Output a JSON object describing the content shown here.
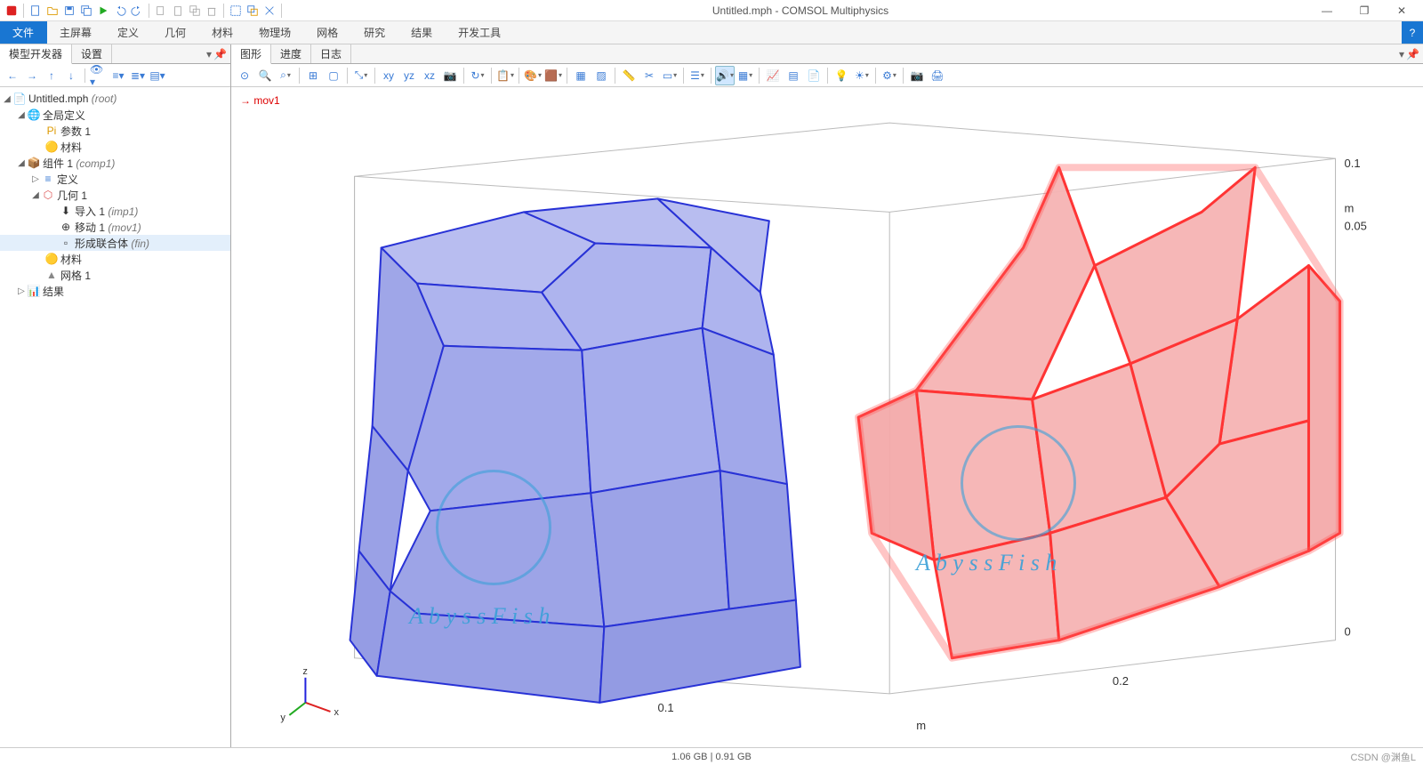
{
  "window": {
    "title": "Untitled.mph - COMSOL Multiphysics"
  },
  "ribbon": {
    "file": "文件",
    "tabs": [
      "主屏幕",
      "定义",
      "几何",
      "材料",
      "物理场",
      "网格",
      "研究",
      "结果",
      "开发工具"
    ],
    "help": "?"
  },
  "left": {
    "tabs": {
      "builder": "模型开发器",
      "settings": "设置"
    },
    "tree": {
      "root": {
        "label": "Untitled.mph",
        "suffix": "(root)"
      },
      "global": "全局定义",
      "params": "参数 1",
      "materials": "材料",
      "comp": {
        "label": "组件 1",
        "suffix": "(comp1)"
      },
      "defs": "定义",
      "geom": "几何 1",
      "imp": {
        "label": "导入 1",
        "suffix": "(imp1)"
      },
      "mov": {
        "label": "移动 1",
        "suffix": "(mov1)"
      },
      "fin": {
        "label": "形成联合体",
        "suffix": "(fin)"
      },
      "mat2": "材料",
      "mesh": "网格 1",
      "results": "结果"
    }
  },
  "right": {
    "tabs": {
      "graphics": "图形",
      "progress": "进度",
      "log": "日志"
    },
    "selection": "mov1",
    "axes": {
      "x_tick": "0.1",
      "x_tick2": "0.2",
      "x_unit": "m",
      "z_top": "0.1",
      "z_mid": "0.05",
      "z_bot": "0",
      "z_unit": "m",
      "triad": {
        "x": "x",
        "y": "y",
        "z": "z"
      }
    },
    "watermark": "A b y s s F i s h"
  },
  "status": {
    "mem": "1.06 GB | 0.91 GB",
    "credit": "CSDN @渊鱼L"
  }
}
